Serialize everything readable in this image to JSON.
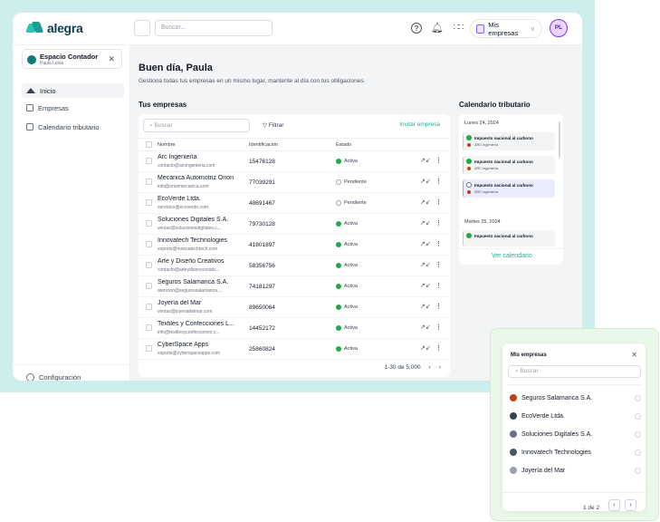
{
  "header": {
    "logo_text": "alegra",
    "search_placeholder": "Buscar...",
    "help_icon": "help-icon",
    "bell_icon": "bell-icon",
    "apps_icon": "apps-grid-icon",
    "companies_button": "Mis empresas",
    "avatar_initials": "PL"
  },
  "sidebar": {
    "workspace": {
      "title": "Espacio Contador",
      "subtitle": "Paula Leiva"
    },
    "items": [
      {
        "label": "Inicio",
        "icon": "home-icon",
        "active": true
      },
      {
        "label": "Empresas",
        "icon": "building-icon",
        "active": false
      },
      {
        "label": "Calendario tributario",
        "icon": "calendar-icon",
        "active": false
      }
    ],
    "settings_label": "Configuración"
  },
  "main": {
    "greeting": "Buen día, Paula",
    "subtitle": "Gestiona todas tus empresas en un mismo lugar, mantente al día con tus obligaciones.",
    "companies_title": "Tus empresas",
    "table": {
      "search_placeholder": "Buscar",
      "filter_label": "Filtrar",
      "invite_label": "Invitar empresa",
      "headers": {
        "name": "Nombre",
        "id": "Identificación",
        "status": "Estado"
      },
      "rows": [
        {
          "name": "Arc Ingeniería",
          "email": "contacto@arcingenieria.com",
          "id": "15476128",
          "status": "Activa",
          "state": "ok"
        },
        {
          "name": "Mecánica Automotriz Orion",
          "email": "info@orionmecanica.com",
          "id": "77039291",
          "status": "Pendiente",
          "state": "pend"
        },
        {
          "name": "EcoVerde Ltda.",
          "email": "servicios@ecoverde.com",
          "id": "48691467",
          "status": "Pendiente",
          "state": "pend"
        },
        {
          "name": "Soluciones Digitales S.A.",
          "email": "ventas@solucionesdigitales.c...",
          "id": "79730128",
          "status": "Activa",
          "state": "ok"
        },
        {
          "name": "Innovatech Technologies",
          "email": "soporte@innovatechtech.com",
          "id": "41801897",
          "status": "Activa",
          "state": "ok"
        },
        {
          "name": "Arte y Diseño Creativos",
          "email": "contacto@arteydisenocreativ...",
          "id": "58356756",
          "status": "Activa",
          "state": "ok"
        },
        {
          "name": "Seguros Salamanca S.A.",
          "email": "atencion@segurossalamanca....",
          "id": "74181297",
          "status": "Activa",
          "state": "ok"
        },
        {
          "name": "Joyería del Mar",
          "email": "ventas@joyeriadelmar.com",
          "id": "89650064",
          "status": "Activa",
          "state": "ok"
        },
        {
          "name": "Textiles y Confecciones L...",
          "email": "info@textilesyconfecciones.c...",
          "id": "14452172",
          "status": "Activa",
          "state": "ok"
        },
        {
          "name": "CyberSpace Apps",
          "email": "soporte@cyberspaceapps.com",
          "id": "25860824",
          "status": "Activa",
          "state": "ok"
        }
      ],
      "pagination": "1-30 de 5,000"
    },
    "calendar": {
      "title": "Calendario tributario",
      "day1": "Lunes 24, 2024",
      "events1": [
        {
          "title": "Impuesto nacional al carbono",
          "company": "ARC Ingeniería",
          "state": "ok",
          "selected": false
        },
        {
          "title": "Impuesto nacional al carbono",
          "company": "ARC Ingeniería",
          "state": "ok",
          "selected": false
        },
        {
          "title": "Impuesto nacional al carbono",
          "company": "ARC Ingeniería",
          "state": "pend",
          "selected": true
        }
      ],
      "day2": "Martes 25, 2024",
      "events2": [
        {
          "title": "Impuesto nacional al carbono",
          "state": "ok"
        }
      ],
      "view_more": "Ver calendario"
    }
  },
  "popup": {
    "title": "Mis empresas",
    "search_placeholder": "Buscar",
    "items": [
      {
        "label": "Seguros Salamanca S.A.",
        "color": "#c2410c"
      },
      {
        "label": "EcoVerde Ltda.",
        "color": "#374151"
      },
      {
        "label": "Soluciones Digitales S.A.",
        "color": "#6b7280"
      },
      {
        "label": "Innovatech Technologies",
        "color": "#4b5563"
      },
      {
        "label": "Joyería del Mar",
        "color": "#9ca3af"
      }
    ],
    "page": "1 de 2"
  }
}
